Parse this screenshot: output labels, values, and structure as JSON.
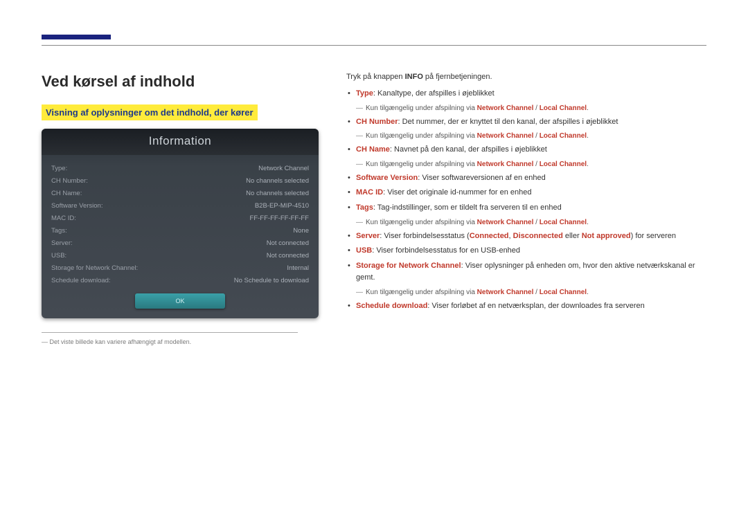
{
  "page_title": "Ved kørsel af indhold",
  "section_title": "Visning af oplysninger om det indhold, der kører",
  "info_panel": {
    "header": "Information",
    "rows": [
      {
        "label": "Type:",
        "value": "Network Channel"
      },
      {
        "label": "CH Number:",
        "value": "No channels selected"
      },
      {
        "label": "CH Name:",
        "value": "No channels selected"
      },
      {
        "label": "Software Version:",
        "value": "B2B-EP-MIP-4510"
      },
      {
        "label": "MAC ID:",
        "value": "FF-FF-FF-FF-FF-FF"
      },
      {
        "label": "Tags:",
        "value": "None"
      },
      {
        "label": "Server:",
        "value": "Not connected"
      },
      {
        "label": "USB:",
        "value": "Not connected"
      },
      {
        "label": "Storage for Network Channel:",
        "value": "Internal"
      },
      {
        "label": "Schedule download:",
        "value": "No Schedule to download"
      }
    ],
    "ok_label": "OK"
  },
  "footnote": "Det viste billede kan variere afhængigt af modellen.",
  "intro": {
    "prefix": "Tryk på knappen ",
    "bold": "INFO",
    "suffix": " på fjernbetjeningen."
  },
  "subnote_common": {
    "prefix": "Kun tilgængelig under afspilning via ",
    "nc": "Network Channel",
    "sep": " / ",
    "lc": "Local Channel",
    "end": "."
  },
  "items": {
    "type": {
      "name": "Type",
      "desc": ": Kanaltype, der afspilles i øjeblikket"
    },
    "ch_number": {
      "name": "CH Number",
      "desc": ": Det nummer, der er knyttet til den kanal, der afspilles i øjeblikket"
    },
    "ch_name": {
      "name": "CH Name",
      "desc": ": Navnet på den kanal, der afspilles i øjeblikket"
    },
    "software_version": {
      "name": "Software Version",
      "desc": ": Viser softwareversionen af en enhed"
    },
    "mac_id": {
      "name": "MAC ID",
      "desc": ": Viser det originale id-nummer for en enhed"
    },
    "tags": {
      "name": "Tags",
      "desc": ": Tag-indstillinger, som er tildelt fra serveren til en enhed"
    },
    "server": {
      "name": "Server",
      "prefix": ": Viser forbindelsesstatus (",
      "connected": "Connected",
      "disconnected": "Disconnected",
      "not_approved": "Not approved",
      "comma": ", ",
      "or": " eller ",
      "suffix": ") for serveren"
    },
    "usb": {
      "name": "USB",
      "desc": ": Viser forbindelsesstatus for en USB-enhed"
    },
    "storage": {
      "name": "Storage for Network Channel",
      "desc": ": Viser oplysninger på enheden om, hvor den aktive netværkskanal er gemt."
    },
    "schedule": {
      "name": "Schedule download",
      "desc": ": Viser forløbet af en netværksplan, der downloades fra serveren"
    }
  }
}
